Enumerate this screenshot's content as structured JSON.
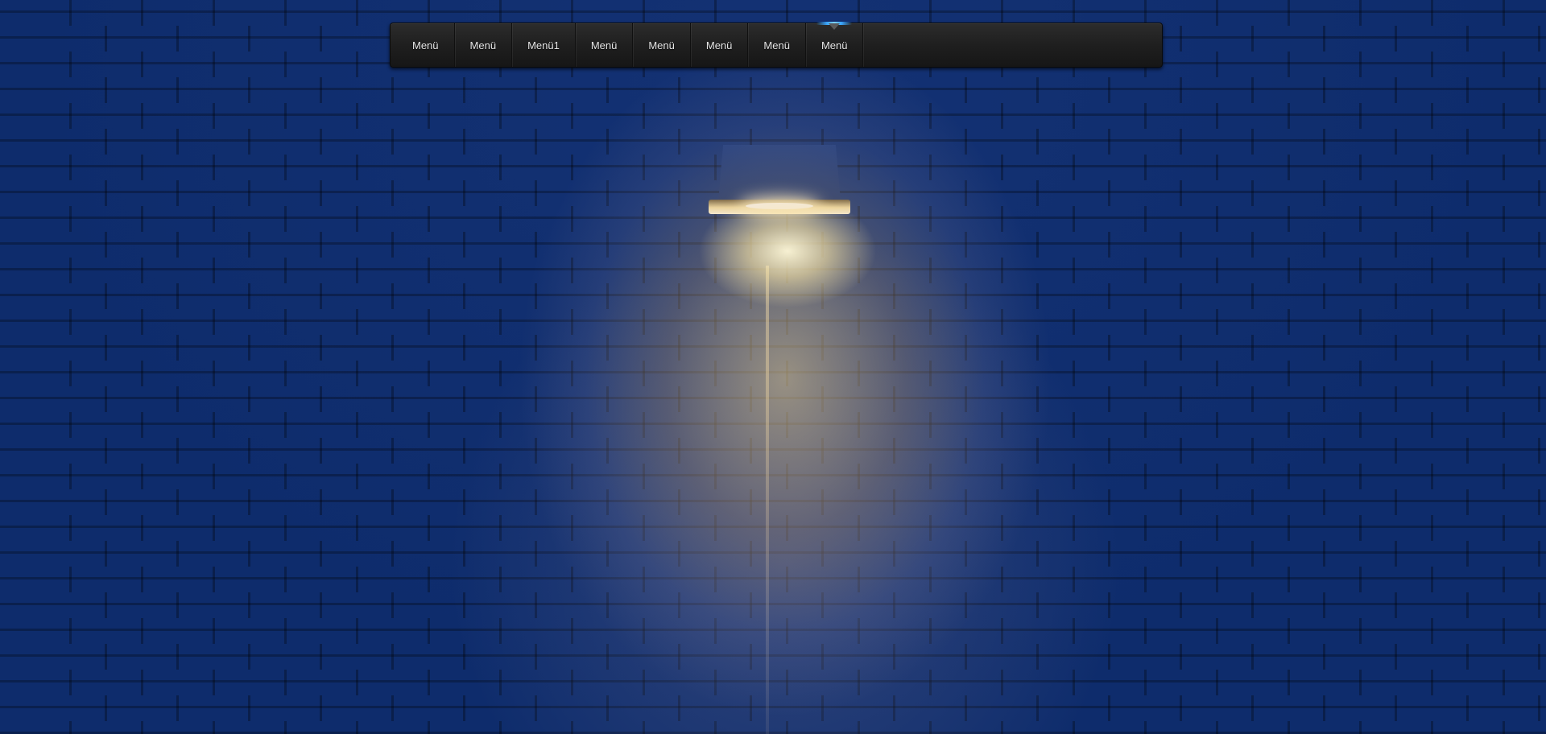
{
  "background": {
    "description_icon": "brick-wall-lamp-image",
    "wall_color": "#0e2c6c",
    "light_color": "#fbe1a0"
  },
  "navbar": {
    "bar_color": "#1f1f1f",
    "text_color": "#e6e6e6",
    "active_accent": "#3aa6ff",
    "items": [
      {
        "label": "Menü"
      },
      {
        "label": "Menü"
      },
      {
        "label": "Menü1"
      },
      {
        "label": "Menü"
      },
      {
        "label": "Menü"
      },
      {
        "label": "Menü"
      },
      {
        "label": "Menü"
      },
      {
        "label": "Menü"
      }
    ],
    "active_index": 7
  }
}
